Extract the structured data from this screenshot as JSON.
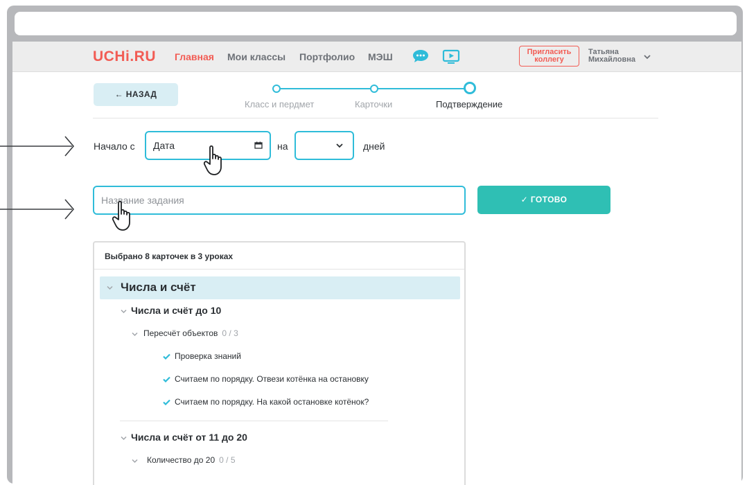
{
  "header": {
    "logo": "UCHi.RU",
    "nav": [
      "Главная",
      "Мои классы",
      "Портфолио",
      "МЭШ"
    ],
    "invite_line1": "Пригласить",
    "invite_line2": "коллегу",
    "user_first": "Татьяна",
    "user_last": "Михайловна"
  },
  "stepper": {
    "back_label": "← НАЗАД",
    "steps": [
      "Класс и пердмет",
      "Карточки",
      "Подтверждение"
    ]
  },
  "schedule": {
    "start_label": "Начало с",
    "date_value": "Дата",
    "on_label": "на",
    "days_label": "дней"
  },
  "task": {
    "placeholder": "Название задания",
    "done_label": "✓ ГОТОВО"
  },
  "cards": {
    "summary": "Выбрано 8 карточек в 3 уроках",
    "topic": "Числа и счёт",
    "sections": [
      {
        "title": "Числа и счёт до 10",
        "lesson": "Пересчёт объектов",
        "count": "0 / 3",
        "items": [
          "Проверка знаний",
          "Считаем по порядку. Отвези котёнка на остановку",
          "Считаем по порядку. На какой остановке котёнок?"
        ]
      },
      {
        "title": "Числа и счёт от 11 до 20",
        "lesson": "Количество до 20",
        "count": "0 / 5"
      }
    ]
  },
  "colors": {
    "brand": "#f25c54",
    "accent": "#2fbcd9",
    "done": "#2fbfb4"
  }
}
